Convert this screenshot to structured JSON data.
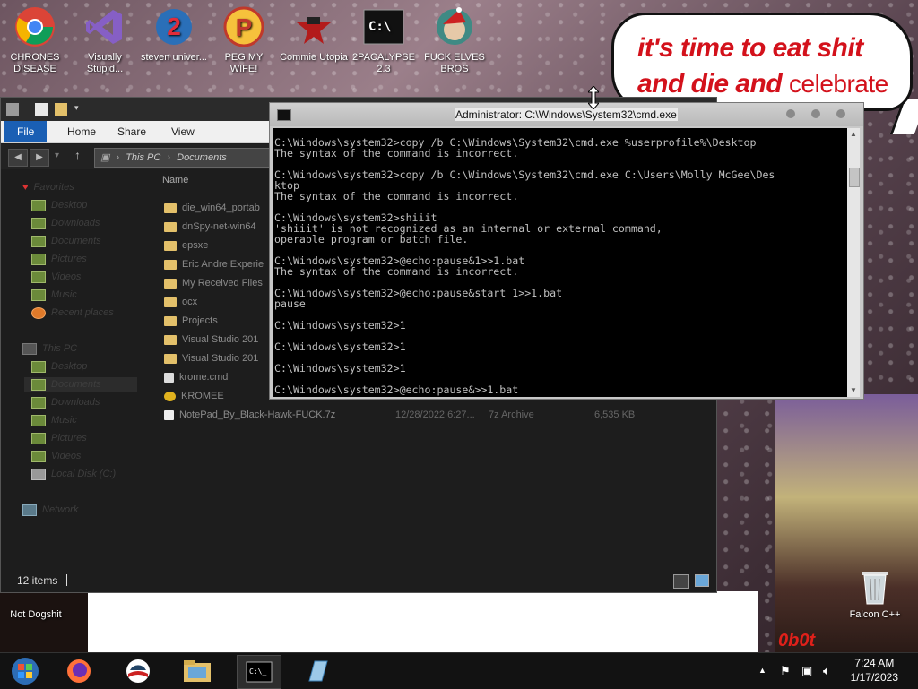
{
  "desktop": {
    "icons": [
      {
        "label": "CHRONES DISEASE"
      },
      {
        "label": "Visually Stupid..."
      },
      {
        "label": "steven univer..."
      },
      {
        "label": "PEG MY WIFE!"
      },
      {
        "label": "Commie Utopia"
      },
      {
        "label": "2PACALYPSE 2.3"
      },
      {
        "label": "FUCK ELVES BROS"
      }
    ],
    "bottom_icons": [
      {
        "label": "Not Dogshit"
      },
      {
        "label": "Falcon C++"
      }
    ],
    "bubble": {
      "line1": "it's time to eat shit",
      "line2_bold": "and die and",
      "line2_plain": "celebrate"
    },
    "banner_text": "0b0t"
  },
  "explorer": {
    "tabs": {
      "file": "File",
      "home": "Home",
      "share": "Share",
      "view": "View"
    },
    "address": {
      "part1": "This PC",
      "part2": "Documents"
    },
    "column_name": "Name",
    "nav": {
      "favorites": "Favorites",
      "fav_items": [
        "Desktop",
        "Downloads",
        "Documents",
        "Pictures",
        "Videos",
        "Music",
        "Recent places"
      ],
      "thispc": "This PC",
      "pc_items": [
        "Desktop",
        "Documents",
        "Downloads",
        "Music",
        "Pictures",
        "Videos",
        "Local Disk (C:)"
      ],
      "network": "Network"
    },
    "files": [
      {
        "name": "die_win64_portab"
      },
      {
        "name": "dnSpy-net-win64"
      },
      {
        "name": "epsxe"
      },
      {
        "name": "Eric Andre Experie"
      },
      {
        "name": "My Received Files"
      },
      {
        "name": "ocx"
      },
      {
        "name": "Projects"
      },
      {
        "name": "Visual Studio 201"
      },
      {
        "name": "Visual Studio 201"
      },
      {
        "name": "krome.cmd"
      },
      {
        "name": "KROMEE"
      },
      {
        "name": "NotePad_By_Black-Hawk-FUCK.7z",
        "date": "12/28/2022 6:27...",
        "type": "7z Archive",
        "size": "6,535 KB"
      }
    ],
    "status": "12 items"
  },
  "cmd": {
    "title": "Administrator: C:\\Windows\\System32\\cmd.exe",
    "text": "C:\\Windows\\system32>copy /b C:\\Windows\\System32\\cmd.exe %userprofile%\\Desktop\nThe syntax of the command is incorrect.\n\nC:\\Windows\\system32>copy /b C:\\Windows\\System32\\cmd.exe C:\\Users\\Molly McGee\\Des\nktop\nThe syntax of the command is incorrect.\n\nC:\\Windows\\system32>shiiit\n'shiiit' is not recognized as an internal or external command,\noperable program or batch file.\n\nC:\\Windows\\system32>@echo:pause&1>>1.bat\nThe syntax of the command is incorrect.\n\nC:\\Windows\\system32>@echo:pause&start 1>>1.bat\npause\n\nC:\\Windows\\system32>1\n\nC:\\Windows\\system32>1\n\nC:\\Windows\\system32>1\n\nC:\\Windows\\system32>@echo:pause&>>1.bat"
  },
  "taskbar": {
    "time": "7:24 AM",
    "date": "1/17/2023"
  }
}
